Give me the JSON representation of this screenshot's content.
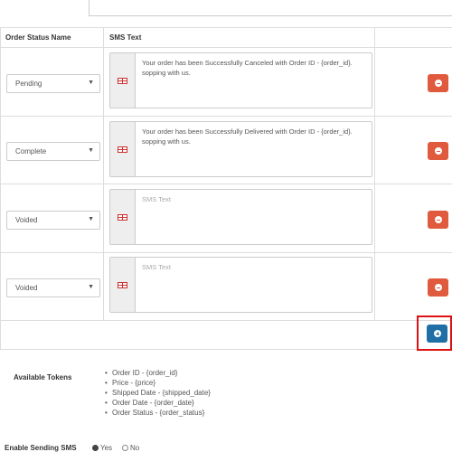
{
  "table": {
    "headers": {
      "status": "Order Status Name",
      "sms": "SMS Text"
    },
    "rows": [
      {
        "status": "Pending",
        "sms_text": "Your order has been Successfully Canceled with Order ID - {order_id}. sopping with us.",
        "is_placeholder": false
      },
      {
        "status": "Complete",
        "sms_text": "Your order has been Successfully Delivered with Order ID - {order_id}. sopping with us.",
        "is_placeholder": false
      },
      {
        "status": "Voided",
        "sms_text": "SMS Text",
        "is_placeholder": true
      },
      {
        "status": "Voided",
        "sms_text": "SMS Text",
        "is_placeholder": true
      }
    ],
    "caret": "▼"
  },
  "tokens": {
    "label": "Available Tokens",
    "items": [
      "Order ID - {order_id}",
      "Price - {price}",
      "Shipped Date - {shipped_date}",
      "Order Date - {order_date}",
      "Order Status - {order_status}"
    ]
  },
  "enable_sms": {
    "label": "Enable Sending SMS",
    "options": [
      "Yes",
      "No"
    ],
    "selected": "Yes"
  },
  "colors": {
    "remove_button": "#e05a3d",
    "add_button": "#1f6fa6",
    "highlight": "#dd1111"
  }
}
